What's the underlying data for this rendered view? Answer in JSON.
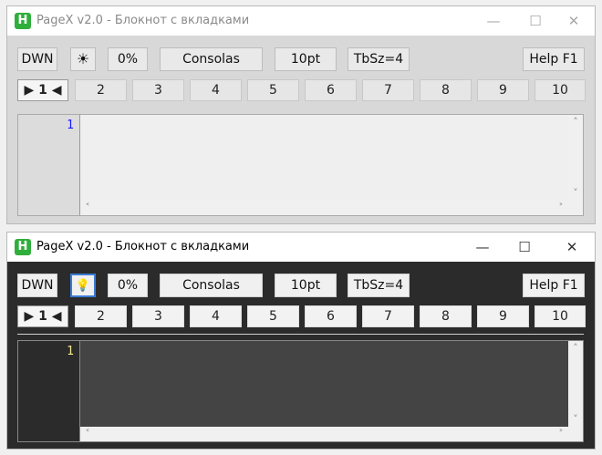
{
  "windows": [
    {
      "title": "PageX v2.0 - Блокнот с вкладками",
      "theme": "light",
      "app_icon_letter": "H",
      "controls": {
        "minimize": "—",
        "maximize": "☐",
        "close": "✕"
      },
      "toolbar": {
        "down": "DWN",
        "theme_icon": "☀",
        "percent": "0%",
        "font": "Consolas",
        "size": "10pt",
        "tab_size": "TbSz=4",
        "help": "Help F1"
      },
      "tabs": {
        "active": "▶ 1 ◀",
        "items": [
          "2",
          "3",
          "4",
          "5",
          "6",
          "7",
          "8",
          "9",
          "10"
        ]
      },
      "editor": {
        "line_number": "1",
        "arrows": {
          "up": "˄",
          "down": "˅",
          "left": "˂",
          "right": "˃"
        }
      }
    },
    {
      "title": "PageX v2.0 - Блокнот с вкладками",
      "theme": "dark",
      "app_icon_letter": "H",
      "controls": {
        "minimize": "—",
        "maximize": "☐",
        "close": "✕"
      },
      "toolbar": {
        "down": "DWN",
        "theme_icon": "💡",
        "percent": "0%",
        "font": "Consolas",
        "size": "10pt",
        "tab_size": "TbSz=4",
        "help": "Help F1"
      },
      "tabs": {
        "active": "▶ 1 ◀",
        "items": [
          "2",
          "3",
          "4",
          "5",
          "6",
          "7",
          "8",
          "9",
          "10"
        ]
      },
      "editor": {
        "line_number": "1",
        "arrows": {
          "up": "˄",
          "down": "˅",
          "left": "˂",
          "right": "˃"
        }
      }
    }
  ],
  "colors": {
    "app_icon": "#2fae3b",
    "gutter_light_text": "#1a1aff",
    "gutter_dark_text": "#f0e68c",
    "dark_bg": "#2b2b2b",
    "focus_border": "#3b7bd4"
  }
}
